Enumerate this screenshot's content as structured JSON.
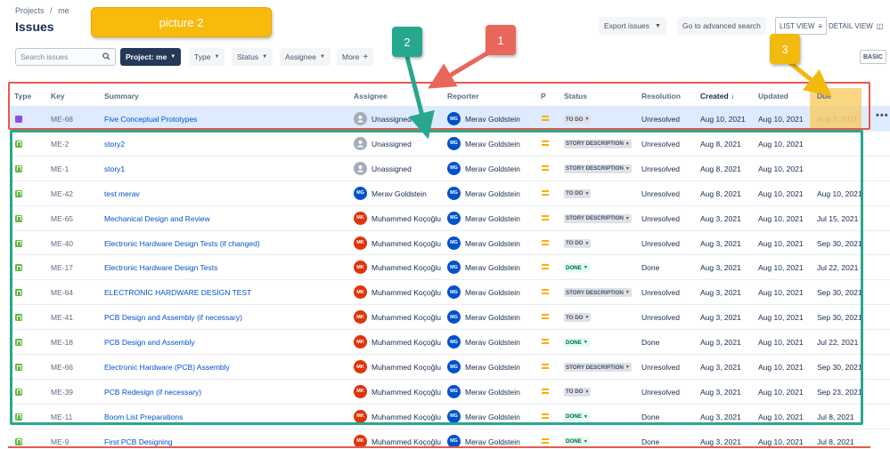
{
  "breadcrumb": [
    "Projects",
    "/",
    "me"
  ],
  "page_title": "Issues",
  "picture_label": "picture 2",
  "toolbar": {
    "export": "Export issues",
    "advanced": "Go to advanced search",
    "list_view": "LIST VIEW",
    "detail_view": "DETAIL VIEW",
    "basic": "BASIC"
  },
  "filters": {
    "search_placeholder": "Search issues",
    "project": "Project: me",
    "type": "Type",
    "status": "Status",
    "assignee": "Assignee",
    "more": "More"
  },
  "columns": {
    "type": "Type",
    "key": "Key",
    "summary": "Summary",
    "assignee": "Assignee",
    "reporter": "Reporter",
    "priority": "P",
    "status": "Status",
    "resolution": "Resolution",
    "created": "Created",
    "updated": "Updated",
    "due": "Due"
  },
  "callouts": [
    "1",
    "2",
    "3"
  ],
  "colors": {
    "callout_1": "#e8675a",
    "callout_2": "#27a88d",
    "callout_3": "#f2b90f",
    "picture_label": "#f8bb0c",
    "link": "#0052cc"
  },
  "rows": [
    {
      "type": "epic",
      "key": "ME-68",
      "summary": "Five Conceptual Prototypes",
      "assignee": "Unassigned",
      "assignee_avatar": "un",
      "assignee_initials": "",
      "reporter": "Merav Goldstein",
      "reporter_initials": "MG",
      "status": "TO DO",
      "status_kind": "todo",
      "resolution": "Unresolved",
      "created": "Aug 10, 2021",
      "updated": "Aug 10, 2021",
      "due": "Aug 2, 2021"
    },
    {
      "type": "story",
      "key": "ME-2",
      "summary": "story2",
      "assignee": "Unassigned",
      "assignee_avatar": "un",
      "assignee_initials": "",
      "reporter": "Merav Goldstein",
      "reporter_initials": "MG",
      "status": "STORY DESCRIPTION",
      "status_kind": "desc",
      "resolution": "Unresolved",
      "created": "Aug 8, 2021",
      "updated": "Aug 10, 2021",
      "due": ""
    },
    {
      "type": "story",
      "key": "ME-1",
      "summary": "story1",
      "assignee": "Unassigned",
      "assignee_avatar": "un",
      "assignee_initials": "",
      "reporter": "Merav Goldstein",
      "reporter_initials": "MG",
      "status": "STORY DESCRIPTION",
      "status_kind": "desc",
      "resolution": "Unresolved",
      "created": "Aug 8, 2021",
      "updated": "Aug 10, 2021",
      "due": ""
    },
    {
      "type": "story",
      "key": "ME-42",
      "summary": "test merav",
      "assignee": "Merav Goldstein",
      "assignee_avatar": "mg",
      "assignee_initials": "MG",
      "reporter": "Merav Goldstein",
      "reporter_initials": "MG",
      "status": "TO DO",
      "status_kind": "todo",
      "resolution": "Unresolved",
      "created": "Aug 8, 2021",
      "updated": "Aug 10, 2021",
      "due": "Aug 10, 2021"
    },
    {
      "type": "story",
      "key": "ME-65",
      "summary": "Mechanical Design and Review",
      "assignee": "Muhammed Koçoğlu",
      "assignee_avatar": "mk",
      "assignee_initials": "MK",
      "reporter": "Merav Goldstein",
      "reporter_initials": "MG",
      "status": "STORY DESCRIPTION",
      "status_kind": "desc",
      "resolution": "Unresolved",
      "created": "Aug 3, 2021",
      "updated": "Aug 10, 2021",
      "due": "Jul 15, 2021"
    },
    {
      "type": "story",
      "key": "ME-40",
      "summary": "Electronic Hardware Design Tests (if changed)",
      "assignee": "Muhammed Koçoğlu",
      "assignee_avatar": "mk",
      "assignee_initials": "MK",
      "reporter": "Merav Goldstein",
      "reporter_initials": "MG",
      "status": "TO DO",
      "status_kind": "todo",
      "resolution": "Unresolved",
      "created": "Aug 3, 2021",
      "updated": "Aug 10, 2021",
      "due": "Sep 30, 2021"
    },
    {
      "type": "story",
      "key": "ME-17",
      "summary": "Electronic Hardware Design Tests",
      "assignee": "Muhammed Koçoğlu",
      "assignee_avatar": "mk",
      "assignee_initials": "MK",
      "reporter": "Merav Goldstein",
      "reporter_initials": "MG",
      "status": "DONE",
      "status_kind": "done",
      "resolution": "Done",
      "created": "Aug 3, 2021",
      "updated": "Aug 10, 2021",
      "due": "Jul 22, 2021"
    },
    {
      "type": "story",
      "key": "ME-64",
      "summary": "ELECTRONİC HARDWARE DESİGN TEST",
      "assignee": "Muhammed Koçoğlu",
      "assignee_avatar": "mk",
      "assignee_initials": "MK",
      "reporter": "Merav Goldstein",
      "reporter_initials": "MG",
      "status": "STORY DESCRIPTION",
      "status_kind": "desc",
      "resolution": "Unresolved",
      "created": "Aug 3, 2021",
      "updated": "Aug 10, 2021",
      "due": "Sep 30, 2021"
    },
    {
      "type": "story",
      "key": "ME-41",
      "summary": "PCB Design and Assembly (if necessary)",
      "assignee": "Muhammed Koçoğlu",
      "assignee_avatar": "mk",
      "assignee_initials": "MK",
      "reporter": "Merav Goldstein",
      "reporter_initials": "MG",
      "status": "TO DO",
      "status_kind": "todo",
      "resolution": "Unresolved",
      "created": "Aug 3, 2021",
      "updated": "Aug 10, 2021",
      "due": "Sep 30, 2021"
    },
    {
      "type": "story",
      "key": "ME-18",
      "summary": "PCB Design and Assembly",
      "assignee": "Muhammed Koçoğlu",
      "assignee_avatar": "mk",
      "assignee_initials": "MK",
      "reporter": "Merav Goldstein",
      "reporter_initials": "MG",
      "status": "DONE",
      "status_kind": "done",
      "resolution": "Done",
      "created": "Aug 3, 2021",
      "updated": "Aug 10, 2021",
      "due": "Jul 22, 2021"
    },
    {
      "type": "story",
      "key": "ME-66",
      "summary": "Electronic Hardware (PCB) Assembly",
      "assignee": "Muhammed Koçoğlu",
      "assignee_avatar": "mk",
      "assignee_initials": "MK",
      "reporter": "Merav Goldstein",
      "reporter_initials": "MG",
      "status": "STORY DESCRIPTION",
      "status_kind": "desc",
      "resolution": "Unresolved",
      "created": "Aug 3, 2021",
      "updated": "Aug 10, 2021",
      "due": "Sep 30, 2021"
    },
    {
      "type": "story",
      "key": "ME-39",
      "summary": "PCB Redesign (if necessary)",
      "assignee": "Muhammed Koçoğlu",
      "assignee_avatar": "mk",
      "assignee_initials": "MK",
      "reporter": "Merav Goldstein",
      "reporter_initials": "MG",
      "status": "TO DO",
      "status_kind": "todo",
      "resolution": "Unresolved",
      "created": "Aug 3, 2021",
      "updated": "Aug 10, 2021",
      "due": "Sep 23, 2021"
    },
    {
      "type": "story",
      "key": "ME-11",
      "summary": "Boom List Preparations",
      "assignee": "Muhammed Koçoğlu",
      "assignee_avatar": "mk",
      "assignee_initials": "MK",
      "reporter": "Merav Goldstein",
      "reporter_initials": "MG",
      "status": "DONE",
      "status_kind": "done",
      "resolution": "Done",
      "created": "Aug 3, 2021",
      "updated": "Aug 10, 2021",
      "due": "Jul 8, 2021"
    },
    {
      "type": "story",
      "key": "ME-9",
      "summary": "First PCB Designing",
      "assignee": "Muhammed Koçoğlu",
      "assignee_avatar": "mk",
      "assignee_initials": "MK",
      "reporter": "Merav Goldstein",
      "reporter_initials": "MG",
      "status": "DONE",
      "status_kind": "done",
      "resolution": "Done",
      "created": "Aug 3, 2021",
      "updated": "Aug 10, 2021",
      "due": "Jul 8, 2021"
    }
  ]
}
